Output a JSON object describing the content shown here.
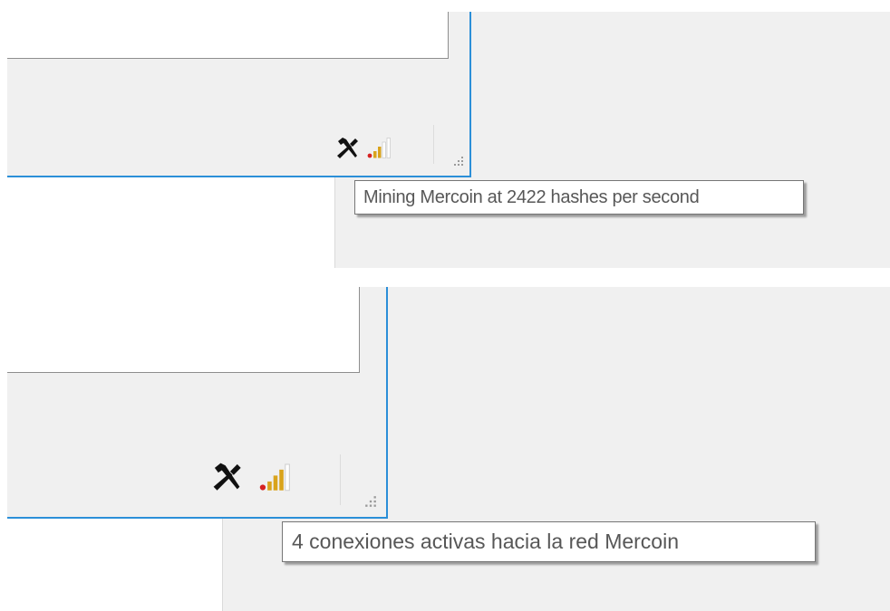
{
  "screens": [
    {
      "tooltip": "Mining Mercoin at 2422 hashes per second",
      "status_icons": [
        "pickaxe-hammer-icon",
        "signal-strength-icon",
        "resize-grip-icon"
      ]
    },
    {
      "tooltip": "4 conexiones activas hacia la red Mercoin",
      "status_icons": [
        "pickaxe-hammer-icon",
        "signal-strength-icon",
        "resize-grip-icon"
      ]
    }
  ],
  "colors": {
    "window_border": "#2b8fd8",
    "window_bg": "#f0f0f0",
    "tooltip_text": "#575757",
    "signal_active": "#d9a31c",
    "signal_dot": "#d62222"
  }
}
